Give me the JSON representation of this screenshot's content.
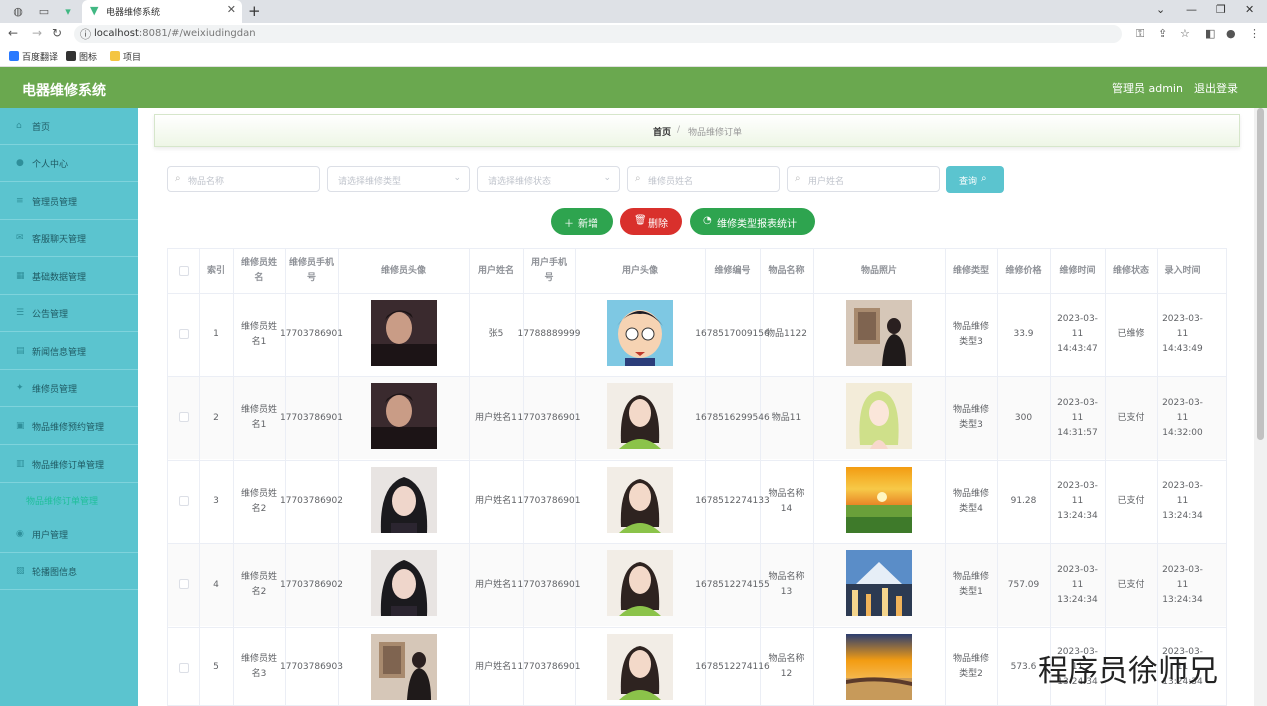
{
  "browser": {
    "tab_title": "电器维修系统",
    "url_host": "localhost",
    "url_rest": ":8081/#/weixiudingdan",
    "bookmarks": [
      "百度翻译",
      "图标",
      "项目"
    ]
  },
  "app": {
    "brand": "电器维修系统",
    "user_label": "管理员 admin",
    "logout_label": "退出登录",
    "colors": {
      "header": "#6aa84f",
      "sidebar": "#5bc4cf",
      "add": "#2ea44f",
      "delete": "#d9302c",
      "stats": "#2ea44f",
      "query": "#5bc4cf"
    }
  },
  "sidebar": {
    "items": [
      {
        "label": "首页",
        "icon": "home-icon"
      },
      {
        "label": "个人中心",
        "icon": "user-icon"
      },
      {
        "label": "管理员管理",
        "icon": "list-icon"
      },
      {
        "label": "客服聊天管理",
        "icon": "chat-icon"
      },
      {
        "label": "基础数据管理",
        "icon": "data-icon"
      },
      {
        "label": "公告管理",
        "icon": "notice-icon"
      },
      {
        "label": "新闻信息管理",
        "icon": "news-icon"
      },
      {
        "label": "维修员管理",
        "icon": "worker-icon"
      },
      {
        "label": "物品维修预约管理",
        "icon": "calendar-icon"
      },
      {
        "label": "物品维修订单管理",
        "icon": "order-icon"
      },
      {
        "label": "用户管理",
        "icon": "users-icon"
      },
      {
        "label": "轮播图信息",
        "icon": "image-icon"
      }
    ],
    "active_sub": "物品维修订单管理"
  },
  "breadcrumb": {
    "home": "首页",
    "sep": "/",
    "current": "物品维修订单"
  },
  "search": {
    "item_name": "物品名称",
    "repair_type": "请选择维修类型",
    "repair_status": "请选择维修状态",
    "worker_name": "维修员姓名",
    "user_name": "用户姓名",
    "query_label": "查询"
  },
  "actions": {
    "add": "新增",
    "delete": "删除",
    "stats": "维修类型报表统计"
  },
  "table": {
    "headers": [
      "索引",
      "维修员姓名",
      "维修员手机号",
      "维修员头像",
      "用户姓名",
      "用户手机号",
      "用户头像",
      "维修编号",
      "物品名称",
      "物品照片",
      "维修类型",
      "维修价格",
      "维修时间",
      "维修状态",
      "录入时间"
    ],
    "rows": [
      {
        "index": "1",
        "worker": "维修员姓名1",
        "worker_phone": "17703786901",
        "worker_avatar": "man",
        "user": "张5",
        "user_phone": "17788889999",
        "user_avatar": "cartoon",
        "code": "1678517009156",
        "item": "物品1122",
        "photo": "room",
        "type": "物品维修类型3",
        "price": "33.9",
        "repair_time": "2023-03-11 14:43:47",
        "status": "已维修",
        "created": "2023-03-11 14:43:49"
      },
      {
        "index": "2",
        "worker": "维修员姓名1",
        "worker_phone": "17703786901",
        "worker_avatar": "man",
        "user": "用户姓名1",
        "user_phone": "17703786901",
        "user_avatar": "girl",
        "code": "1678516299546",
        "item": "物品11",
        "photo": "anime",
        "type": "物品维修类型3",
        "price": "300",
        "repair_time": "2023-03-11 14:31:57",
        "status": "已支付",
        "created": "2023-03-11 14:32:00"
      },
      {
        "index": "3",
        "worker": "维修员姓名2",
        "worker_phone": "17703786902",
        "worker_avatar": "woman",
        "user": "用户姓名1",
        "user_phone": "17703786901",
        "user_avatar": "girl",
        "code": "1678512274133",
        "item": "物品名称14",
        "photo": "sunset",
        "type": "物品维修类型4",
        "price": "91.28",
        "repair_time": "2023-03-11 13:24:34",
        "status": "已支付",
        "created": "2023-03-11 13:24:34"
      },
      {
        "index": "4",
        "worker": "维修员姓名2",
        "worker_phone": "17703786902",
        "worker_avatar": "woman",
        "user": "用户姓名1",
        "user_phone": "17703786901",
        "user_avatar": "girl",
        "code": "1678512274155",
        "item": "物品名称13",
        "photo": "city",
        "type": "物品维修类型1",
        "price": "757.09",
        "repair_time": "2023-03-11 13:24:34",
        "status": "已支付",
        "created": "2023-03-11 13:24:34"
      },
      {
        "index": "5",
        "worker": "维修员姓名3",
        "worker_phone": "17703786903",
        "worker_avatar": "room",
        "user": "用户姓名1",
        "user_phone": "17703786901",
        "user_avatar": "girl",
        "code": "1678512274116",
        "item": "物品名称12",
        "photo": "beach",
        "type": "物品维修类型2",
        "price": "573.6",
        "repair_time": "2023-03-11 13:24:34",
        "status": "",
        "created": "2023-03-11 13:24:34"
      }
    ]
  },
  "watermark": "程序员徐师兄"
}
